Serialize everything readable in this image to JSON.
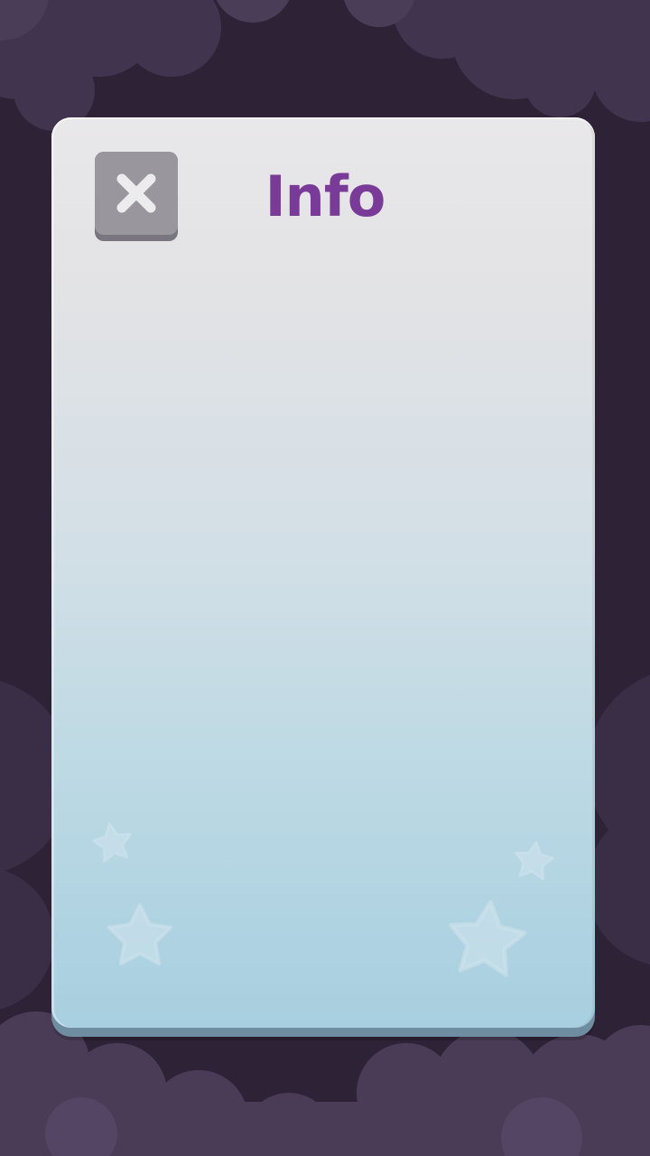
{
  "dialog": {
    "title": "Info",
    "close_icon": "close-icon"
  },
  "colors": {
    "background": "#2e2237",
    "cloud": "#4a3c57",
    "panel_top": "#e8e7e9",
    "panel_bottom": "#a8cfe0",
    "title": "#7a3b98",
    "close_button": "#9a969e",
    "star": "#cfe4ec"
  },
  "decorations": [
    "star-icon",
    "star-icon",
    "star-icon",
    "star-icon"
  ]
}
